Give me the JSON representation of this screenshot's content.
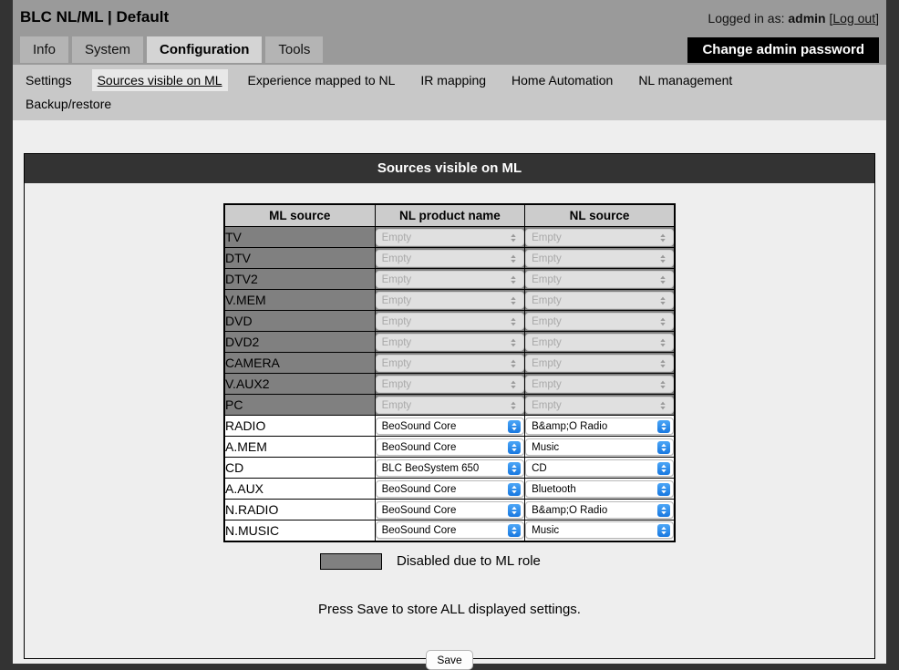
{
  "header": {
    "app_title": "BLC NL/ML | Default",
    "logged_in_prefix": "Logged in as:",
    "username": "admin",
    "logout_open": "[",
    "logout_label": "Log out",
    "logout_close": "]",
    "change_password_button": "Change admin password"
  },
  "tabs": [
    {
      "label": "Info",
      "active": false
    },
    {
      "label": "System",
      "active": false
    },
    {
      "label": "Configuration",
      "active": true
    },
    {
      "label": "Tools",
      "active": false
    }
  ],
  "subtabs": [
    {
      "label": "Settings",
      "active": false
    },
    {
      "label": "Sources visible on ML",
      "active": true
    },
    {
      "label": "Experience mapped to NL",
      "active": false
    },
    {
      "label": "IR mapping",
      "active": false
    },
    {
      "label": "Home Automation",
      "active": false
    },
    {
      "label": "NL management",
      "active": false
    },
    {
      "label": "Backup/restore",
      "active": false
    }
  ],
  "panel": {
    "title": "Sources visible on ML",
    "columns": [
      "ML source",
      "NL product name",
      "NL source"
    ],
    "rows": [
      {
        "ml_source": "TV",
        "nl_product": "Empty",
        "nl_source": "Empty",
        "disabled": true
      },
      {
        "ml_source": "DTV",
        "nl_product": "Empty",
        "nl_source": "Empty",
        "disabled": true
      },
      {
        "ml_source": "DTV2",
        "nl_product": "Empty",
        "nl_source": "Empty",
        "disabled": true
      },
      {
        "ml_source": "V.MEM",
        "nl_product": "Empty",
        "nl_source": "Empty",
        "disabled": true
      },
      {
        "ml_source": "DVD",
        "nl_product": "Empty",
        "nl_source": "Empty",
        "disabled": true
      },
      {
        "ml_source": "DVD2",
        "nl_product": "Empty",
        "nl_source": "Empty",
        "disabled": true
      },
      {
        "ml_source": "CAMERA",
        "nl_product": "Empty",
        "nl_source": "Empty",
        "disabled": true
      },
      {
        "ml_source": "V.AUX2",
        "nl_product": "Empty",
        "nl_source": "Empty",
        "disabled": true
      },
      {
        "ml_source": "PC",
        "nl_product": "Empty",
        "nl_source": "Empty",
        "disabled": true
      },
      {
        "ml_source": "RADIO",
        "nl_product": "BeoSound Core",
        "nl_source": "B&amp;O Radio",
        "disabled": false
      },
      {
        "ml_source": "A.MEM",
        "nl_product": "BeoSound Core",
        "nl_source": "Music",
        "disabled": false
      },
      {
        "ml_source": "CD",
        "nl_product": "BLC BeoSystem 650",
        "nl_source": "CD",
        "disabled": false
      },
      {
        "ml_source": "A.AUX",
        "nl_product": "BeoSound Core",
        "nl_source": "Bluetooth",
        "disabled": false
      },
      {
        "ml_source": "N.RADIO",
        "nl_product": "BeoSound Core",
        "nl_source": "B&amp;O Radio",
        "disabled": false
      },
      {
        "ml_source": "N.MUSIC",
        "nl_product": "BeoSound Core",
        "nl_source": "Music",
        "disabled": false
      }
    ],
    "legend_text": "Disabled due to ML role",
    "save_note": "Press Save to store ALL displayed settings.",
    "save_button": "Save"
  },
  "colors": {
    "outer_frame": "#333333",
    "header_bg": "#9a9a9a",
    "tab_bg": "#b4b4b4",
    "tab_active_bg": "#d4d4d4",
    "subtab_bg": "#c8c8c8",
    "panel_title_bg": "#333333",
    "panel_bg": "#eeeeee",
    "disabled_row": "#808080",
    "table_header": "#cccccc",
    "select_accent": "#2d8cf0",
    "password_button_bg": "#000000"
  }
}
